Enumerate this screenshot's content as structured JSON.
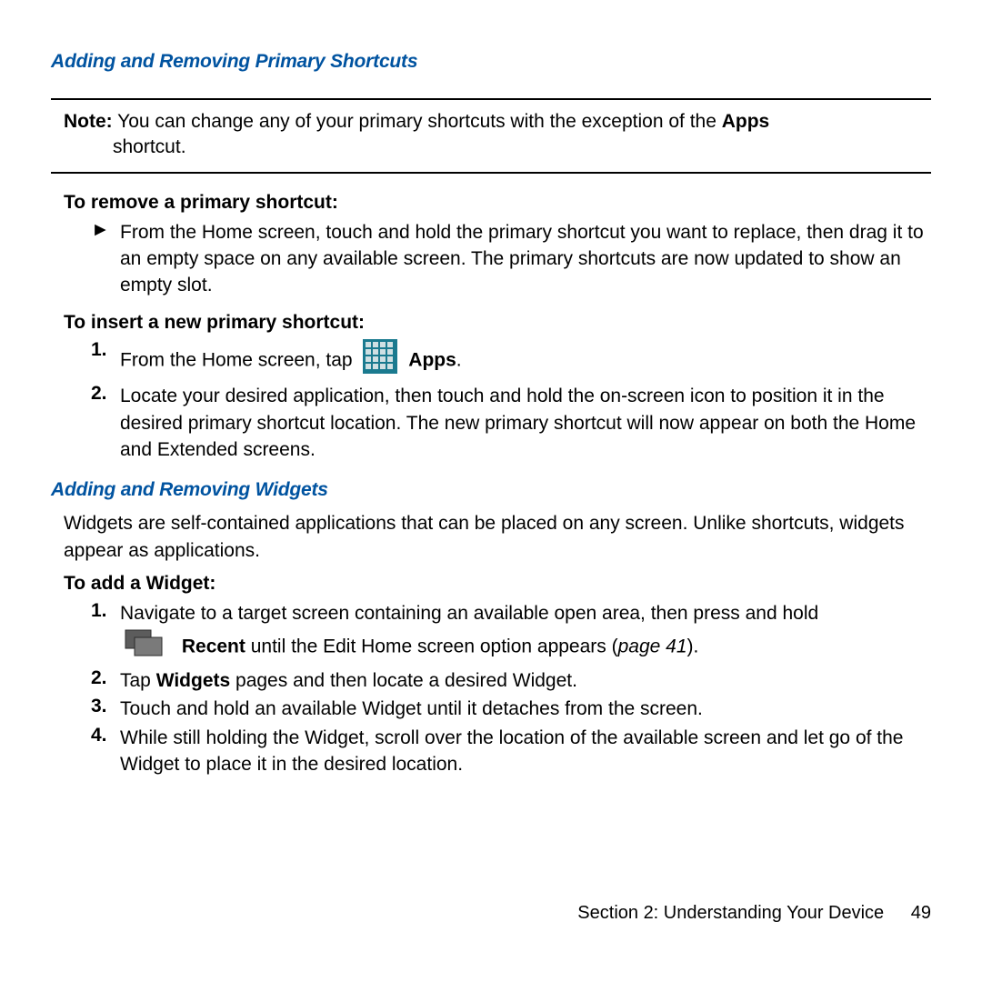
{
  "heading1": "Adding and Removing Primary Shortcuts",
  "note": {
    "label": "Note:",
    "line1a": " You can change any of your primary shortcuts with the exception of the ",
    "line1b_bold": "Apps",
    "line2": "shortcut."
  },
  "removeShortcut": {
    "title": "To remove a primary shortcut:",
    "marker": "►",
    "text": "From the Home screen, touch and hold the primary shortcut you want to replace, then drag it to an empty space on any available screen. The primary shortcuts are now updated to show an empty slot."
  },
  "insertShortcut": {
    "title": "To insert a new primary shortcut:",
    "items": [
      {
        "num": "1.",
        "textPre": "From the Home screen, tap ",
        "hasAppsIcon": true,
        "textBoldAfterIcon": "Apps",
        "textPost": "."
      },
      {
        "num": "2.",
        "textPre": "Locate your desired application, then touch and hold the on-screen icon to position it in the desired primary shortcut location. The new primary shortcut will now appear on both the Home and Extended screens."
      }
    ]
  },
  "heading2": "Adding and Removing Widgets",
  "widgetsIntro": "Widgets are self-contained applications that can be placed on any screen. Unlike shortcuts, widgets appear as applications.",
  "addWidget": {
    "title": "To add a Widget:",
    "items": [
      {
        "num": "1.",
        "line1": "Navigate to a target screen containing an available open area, then press and hold",
        "hasRecentIcon": true,
        "recentBold": "Recent",
        "line2a": " until the Edit Home screen option appears (",
        "line2italic": "page 41",
        "line2b": ")."
      },
      {
        "num": "2.",
        "pre": "Tap ",
        "bold": "Widgets",
        "post": " pages and then locate a desired Widget."
      },
      {
        "num": "3.",
        "pre": "Touch and hold an available Widget until it detaches from the screen."
      },
      {
        "num": "4.",
        "pre": "While still holding the Widget, scroll over the location of the available screen and let go of the Widget to place it in the desired location."
      }
    ]
  },
  "footer": {
    "section": "Section 2:  Understanding Your Device",
    "page": "49"
  }
}
